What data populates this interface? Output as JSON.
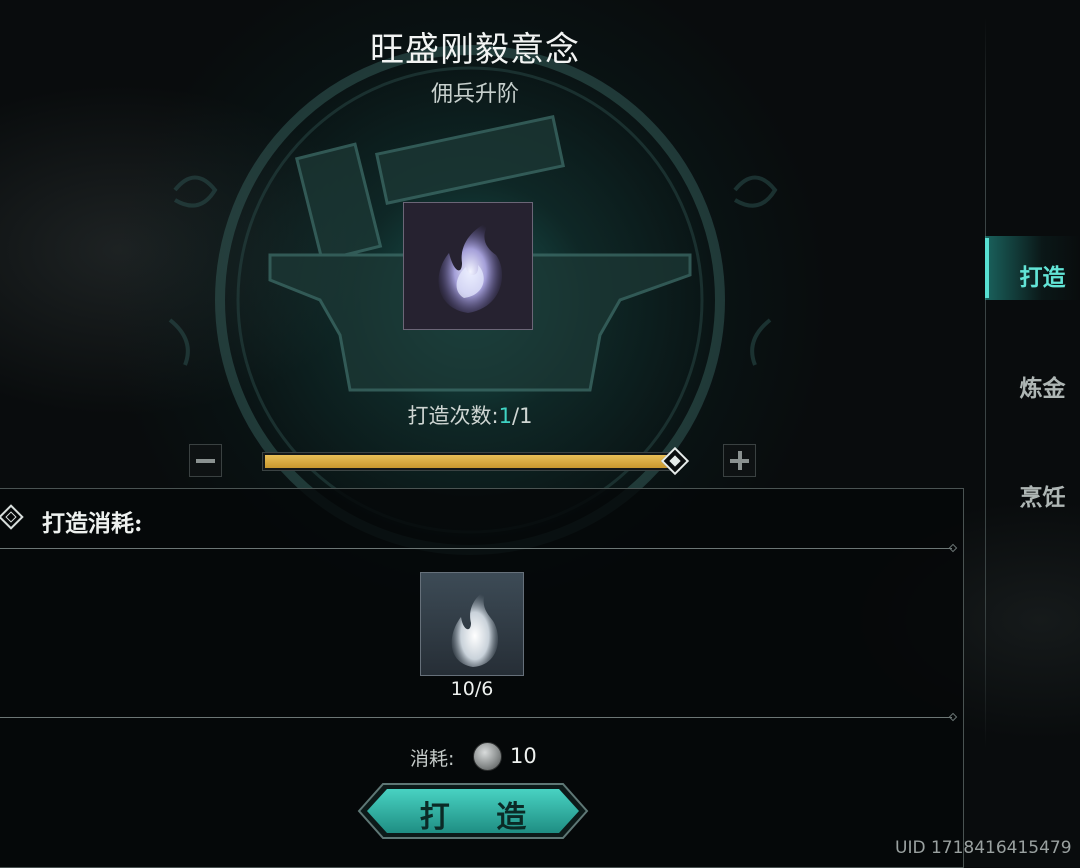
{
  "item": {
    "title": "旺盛刚毅意念",
    "subtitle": "佣兵升阶",
    "icon": "purple-flame-icon"
  },
  "craft_count": {
    "label": "打造次数:",
    "current": "1",
    "separator_total": "/1"
  },
  "quantity_slider": {
    "fill_fraction": 1.0,
    "minus_icon": "minus-icon",
    "plus_icon": "plus-icon",
    "fill_color": "#d7aa42"
  },
  "cost": {
    "header": "打造消耗:",
    "material": {
      "icon": "white-flame-icon",
      "quantity": "10/6"
    },
    "consume_label": "消耗:",
    "consume_icon": "silver-coin-icon",
    "consume_value": "10"
  },
  "craft_button": {
    "label": "打 造",
    "color": "#2fb3a5"
  },
  "side_tabs": [
    {
      "label": "打造",
      "active": true
    },
    {
      "label": "炼金",
      "active": false
    },
    {
      "label": "烹饪",
      "active": false
    }
  ],
  "uid": "UID 1718416415479",
  "accent_color": "#3fd3c3"
}
